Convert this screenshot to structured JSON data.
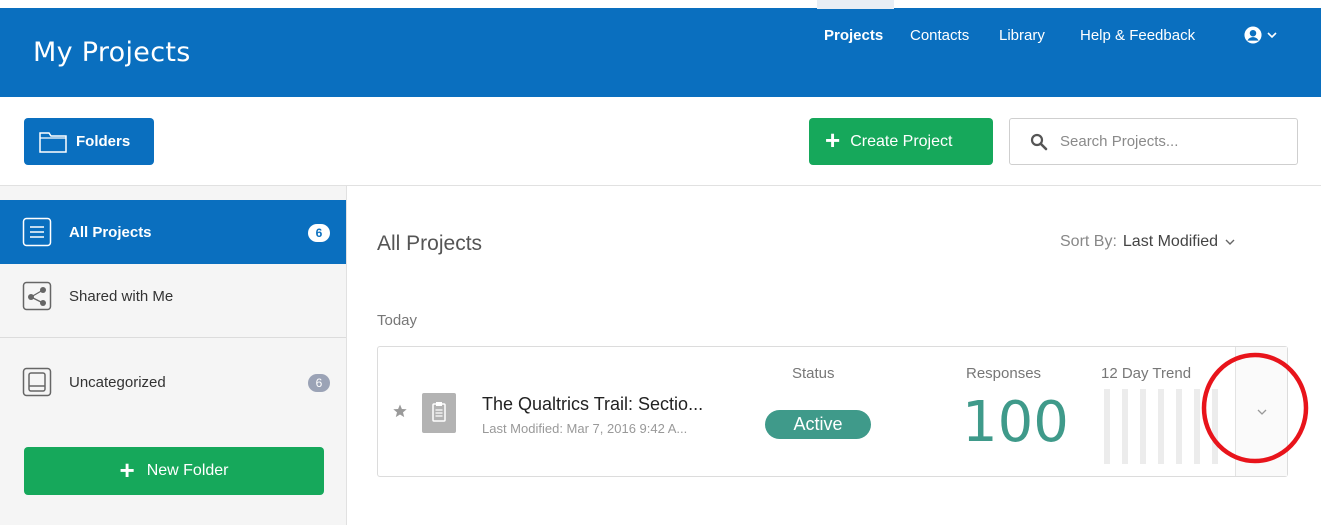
{
  "header": {
    "app_title": "My Projects",
    "nav": [
      {
        "label": "Projects",
        "active": true
      },
      {
        "label": "Contacts",
        "active": false
      },
      {
        "label": "Library",
        "active": false
      },
      {
        "label": "Help & Feedback",
        "active": false
      }
    ],
    "user_icon": "user-circle-icon",
    "brand_color": "#0a6fbf"
  },
  "toolbar": {
    "folders_label": "Folders",
    "create_label": "Create Project",
    "search_placeholder": "Search Projects...",
    "create_color": "#16a85b"
  },
  "sidebar": {
    "items": [
      {
        "label": "All Projects",
        "count": "6",
        "active": true,
        "icon": "list-icon"
      },
      {
        "label": "Shared with Me",
        "count": "",
        "active": false,
        "icon": "share-icon"
      },
      {
        "label": "Uncategorized",
        "count": "6",
        "active": false,
        "icon": "inbox-icon"
      }
    ],
    "new_folder_label": "New Folder"
  },
  "main": {
    "title": "All Projects",
    "sort_label": "Sort By:",
    "sort_value": "Last Modified",
    "group_label": "Today",
    "project": {
      "name": "The Qualtrics Trail: Sectio...",
      "last_modified": "Last Modified: Mar 7, 2016 9:42 A...",
      "status_header": "Status",
      "status": "Active",
      "responses_header": "Responses",
      "responses": "100",
      "trend_header": "12 Day Trend",
      "status_color": "#3f9a8a"
    }
  },
  "annotation_color": "#e8141b"
}
